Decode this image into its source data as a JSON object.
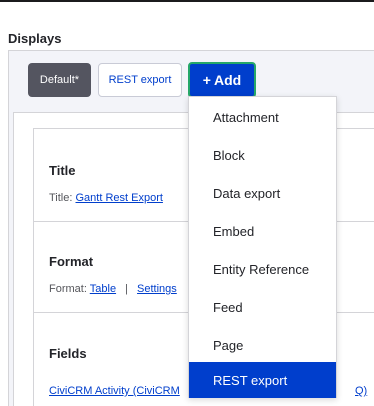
{
  "heading": "Displays",
  "tabs": {
    "default_label": "Default*",
    "rest_label": "REST export",
    "add_symbol": "+",
    "add_label": "Add"
  },
  "sections": {
    "title": {
      "label": "Title",
      "prefix": "Title:",
      "link": "Gantt Rest Export"
    },
    "format": {
      "label": "Format",
      "prefix": "Format:",
      "link1": "Table",
      "separator": "|",
      "link2": "Settings"
    },
    "fields": {
      "label": "Fields",
      "item_start": "CiviCRM Activity (CiviCRM",
      "item_end": "Q)"
    }
  },
  "dropdown": {
    "items": [
      "Attachment",
      "Block",
      "Data export",
      "Embed",
      "Entity Reference",
      "Feed",
      "Page",
      "REST export"
    ],
    "active_index": 7
  },
  "colors": {
    "primary": "#003ecc",
    "focus_border": "#26a769",
    "default_tab": "#545560"
  }
}
